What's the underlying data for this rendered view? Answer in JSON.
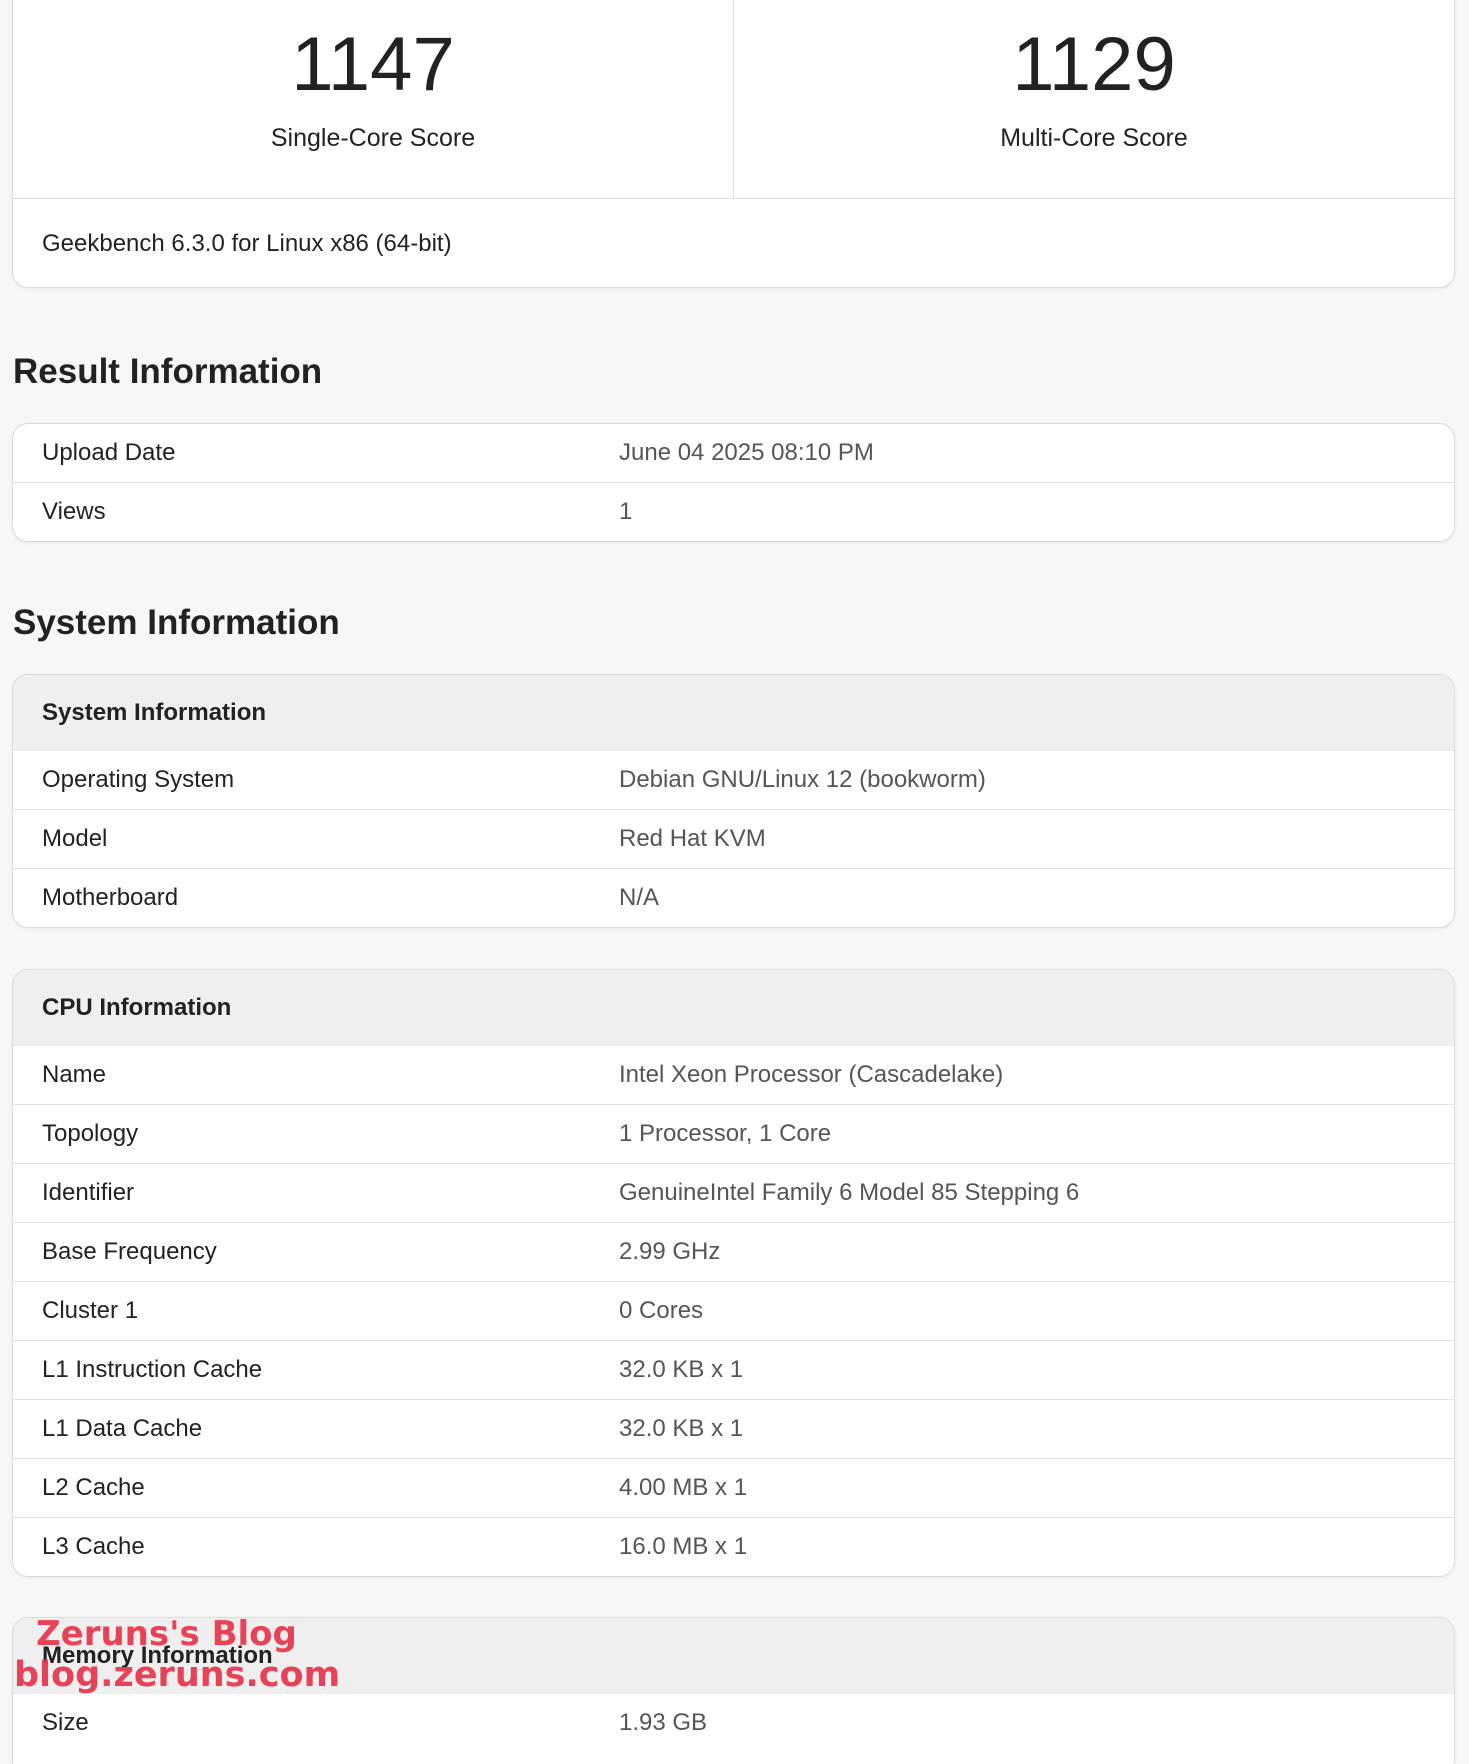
{
  "scores": {
    "single_core_value": "1147",
    "single_core_label": "Single-Core Score",
    "multi_core_value": "1129",
    "multi_core_label": "Multi-Core Score",
    "version": "Geekbench 6.3.0 for Linux x86 (64-bit)"
  },
  "result_info": {
    "title": "Result Information",
    "rows": [
      {
        "key": "Upload Date",
        "value": "June 04 2025 08:10 PM"
      },
      {
        "key": "Views",
        "value": "1"
      }
    ]
  },
  "system_info_section": {
    "title": "System Information"
  },
  "system_info": {
    "header": "System Information",
    "rows": [
      {
        "key": "Operating System",
        "value": "Debian GNU/Linux 12 (bookworm)"
      },
      {
        "key": "Model",
        "value": "Red Hat KVM"
      },
      {
        "key": "Motherboard",
        "value": "N/A"
      }
    ]
  },
  "cpu_info": {
    "header": "CPU Information",
    "rows": [
      {
        "key": "Name",
        "value": "Intel Xeon Processor (Cascadelake)"
      },
      {
        "key": "Topology",
        "value": "1 Processor, 1 Core"
      },
      {
        "key": "Identifier",
        "value": "GenuineIntel Family 6 Model 85 Stepping 6"
      },
      {
        "key": "Base Frequency",
        "value": "2.99 GHz"
      },
      {
        "key": "Cluster 1",
        "value": "0 Cores"
      },
      {
        "key": "L1 Instruction Cache",
        "value": "32.0 KB x 1"
      },
      {
        "key": "L1 Data Cache",
        "value": "32.0 KB x 1"
      },
      {
        "key": "L2 Cache",
        "value": "4.00 MB x 1"
      },
      {
        "key": "L3 Cache",
        "value": "16.0 MB x 1"
      }
    ]
  },
  "memory_info": {
    "header": "Memory Information",
    "rows": [
      {
        "key": "Size",
        "value": "1.93 GB"
      }
    ]
  },
  "watermark": {
    "line1": "Zeruns's Blog",
    "line2": "blog.zeruns.com"
  }
}
